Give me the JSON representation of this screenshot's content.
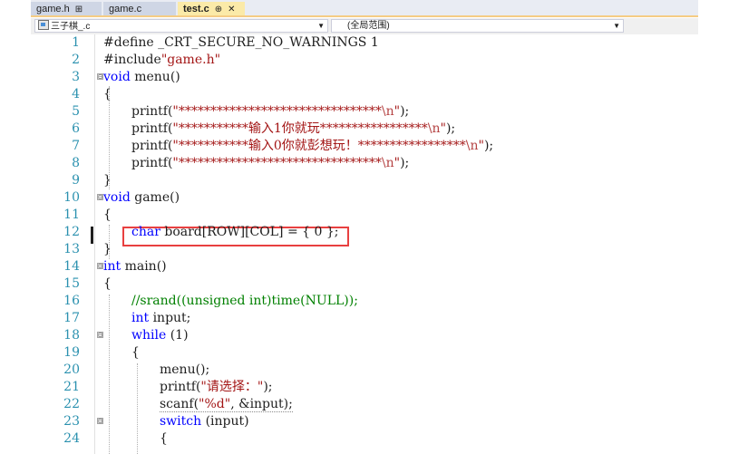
{
  "tabs": [
    {
      "label": "game.h",
      "pin": "⊞",
      "active": false
    },
    {
      "label": "game.c",
      "active": false
    },
    {
      "label": "test.c",
      "pin": "⊕",
      "close": "✕",
      "active": true
    }
  ],
  "navbar": {
    "project": "三子棋_.c",
    "scope": "(全局范围)"
  },
  "lines": [
    {
      "n": "1"
    },
    {
      "n": "2"
    },
    {
      "n": "3"
    },
    {
      "n": "4"
    },
    {
      "n": "5"
    },
    {
      "n": "6"
    },
    {
      "n": "7"
    },
    {
      "n": "8"
    },
    {
      "n": "9"
    },
    {
      "n": "10"
    },
    {
      "n": "11"
    },
    {
      "n": "12"
    },
    {
      "n": "13"
    },
    {
      "n": "14"
    },
    {
      "n": "15"
    },
    {
      "n": "16"
    },
    {
      "n": "17"
    },
    {
      "n": "18"
    },
    {
      "n": "19"
    },
    {
      "n": "20"
    },
    {
      "n": "21"
    },
    {
      "n": "22"
    },
    {
      "n": "23"
    },
    {
      "n": "24"
    }
  ],
  "code": {
    "l1_dir": "#define ",
    "l1_name": "_CRT_SECURE_NO_WARNINGS",
    "l1_val": " 1",
    "l2_dir": "#include",
    "l2_str": "\"game.h\"",
    "l3_kw": "void",
    "l3_rest": " menu()",
    "l4": "{",
    "l5_fn": "printf(",
    "l5_str": "\"********************************",
    "l5_esc": "\\n",
    "l5_end_q": "\"",
    "l5_end": ");",
    "l6_fn": "printf(",
    "l6_str": "\"***********输入1你就玩*****************",
    "l6_esc": "\\n",
    "l6_end_q": "\"",
    "l6_end": ");",
    "l7_fn": "printf(",
    "l7_str": "\"***********输入0你就彭想玩！*****************",
    "l7_esc": "\\n",
    "l7_end_q": "\"",
    "l7_end": ");",
    "l8_fn": "printf(",
    "l8_str": "\"********************************",
    "l8_esc": "\\n",
    "l8_end_q": "\"",
    "l8_end": ");",
    "l9": "}",
    "l10_kw": "void",
    "l10_rest": " game()",
    "l11": "{",
    "l12_kw": "char",
    "l12_rest": " board[ROW][COL] = { 0 };",
    "l13": "}",
    "l14_kw": "int",
    "l14_rest": " main()",
    "l15": "{",
    "l16": "//srand((unsigned int)time(NULL));",
    "l17_kw": "int",
    "l17_rest": " input;",
    "l18_kw": "while",
    "l18_rest": " (1)",
    "l19": "{",
    "l20": "menu();",
    "l21_fn": "printf(",
    "l21_str": "\"请选择：\"",
    "l21_end": ");",
    "l22_fn": "scanf(",
    "l22_str": "\"%d\"",
    "l22_rest": ", &input);",
    "l23_kw": "switch",
    "l23_rest": " (input)",
    "l24": "{"
  },
  "fold_markers": [
    "⊟",
    "⊟",
    "⊟",
    "⊟",
    "⊟"
  ]
}
